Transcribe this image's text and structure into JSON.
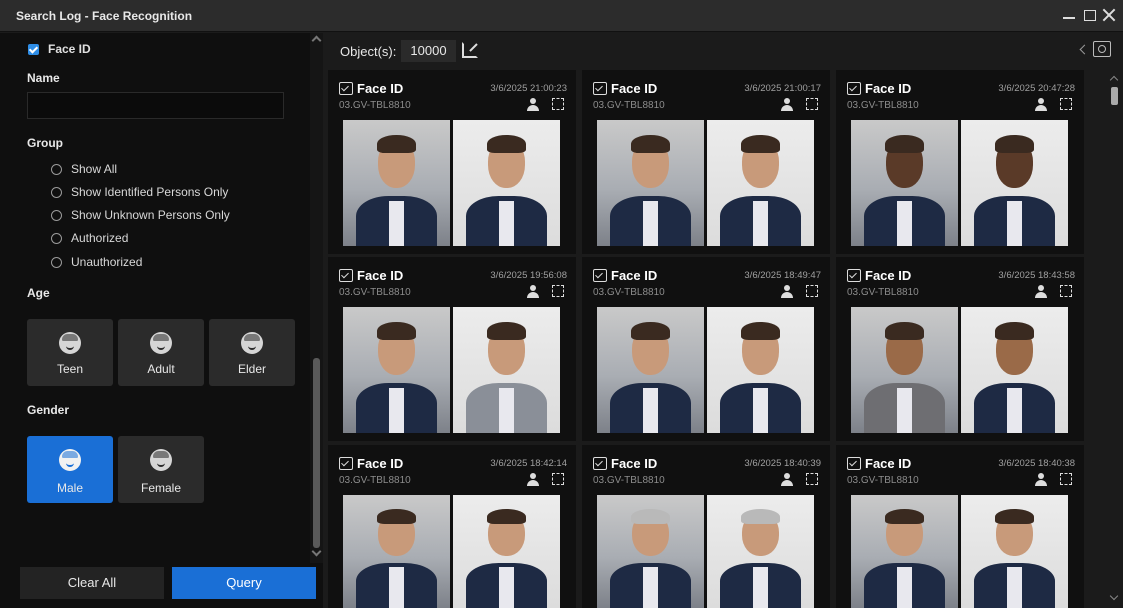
{
  "window": {
    "title": "Search Log - Face Recognition"
  },
  "filters": {
    "face_id_label": "Face ID",
    "face_id_checked": true,
    "name_label": "Name",
    "name_value": "",
    "group_label": "Group",
    "group_options": [
      "Show All",
      "Show Identified Persons Only",
      "Show Unknown Persons Only",
      "Authorized",
      "Unauthorized"
    ],
    "age_label": "Age",
    "age_options": [
      "Teen",
      "Adult",
      "Elder"
    ],
    "gender_label": "Gender",
    "gender_options": [
      "Male",
      "Female"
    ],
    "gender_selected": "Male",
    "clear_label": "Clear All",
    "query_label": "Query"
  },
  "results": {
    "objects_label": "Object(s):",
    "objects_count": "10000",
    "cards": [
      {
        "title": "Face ID",
        "time": "3/6/2025 21:00:23",
        "camera": "03.GV-TBL8810"
      },
      {
        "title": "Face ID",
        "time": "3/6/2025 21:00:17",
        "camera": "03.GV-TBL8810"
      },
      {
        "title": "Face ID",
        "time": "3/6/2025 20:47:28",
        "camera": "03.GV-TBL8810"
      },
      {
        "title": "Face ID",
        "time": "3/6/2025 19:56:08",
        "camera": "03.GV-TBL8810"
      },
      {
        "title": "Face ID",
        "time": "3/6/2025 18:49:47",
        "camera": "03.GV-TBL8810"
      },
      {
        "title": "Face ID",
        "time": "3/6/2025 18:43:58",
        "camera": "03.GV-TBL8810"
      },
      {
        "title": "Face ID",
        "time": "3/6/2025 18:42:14",
        "camera": "03.GV-TBL8810"
      },
      {
        "title": "Face ID",
        "time": "3/6/2025 18:40:39",
        "camera": "03.GV-TBL8810"
      },
      {
        "title": "Face ID",
        "time": "3/6/2025 18:40:38",
        "camera": "03.GV-TBL8810"
      }
    ]
  },
  "colors": {
    "accent": "#1a6fd6",
    "background": "#1b1b1b",
    "panel": "#0f0f0f"
  }
}
